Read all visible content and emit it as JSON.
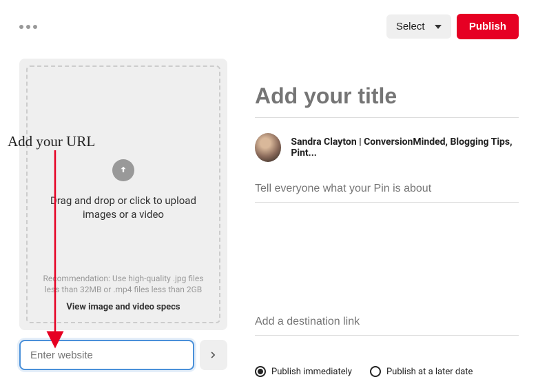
{
  "header": {
    "select_label": "Select",
    "publish_label": "Publish"
  },
  "upload": {
    "drag_text": "Drag and drop or click to upload images or a video",
    "recommendation": "Recommendation: Use high-quality .jpg files less than 32MB or .mp4 files less than 2GB",
    "specs_link": "View image and video specs"
  },
  "url": {
    "placeholder": "Enter website"
  },
  "form": {
    "title_placeholder": "Add your title",
    "author": "Sandra Clayton | ConversionMinded, Blogging Tips, Pint...",
    "desc_placeholder": "Tell everyone what your Pin is about",
    "dest_placeholder": "Add a destination link"
  },
  "publish_options": {
    "immediately": "Publish immediately",
    "later": "Publish at a later date"
  },
  "annotation": {
    "label": "Add your URL"
  }
}
